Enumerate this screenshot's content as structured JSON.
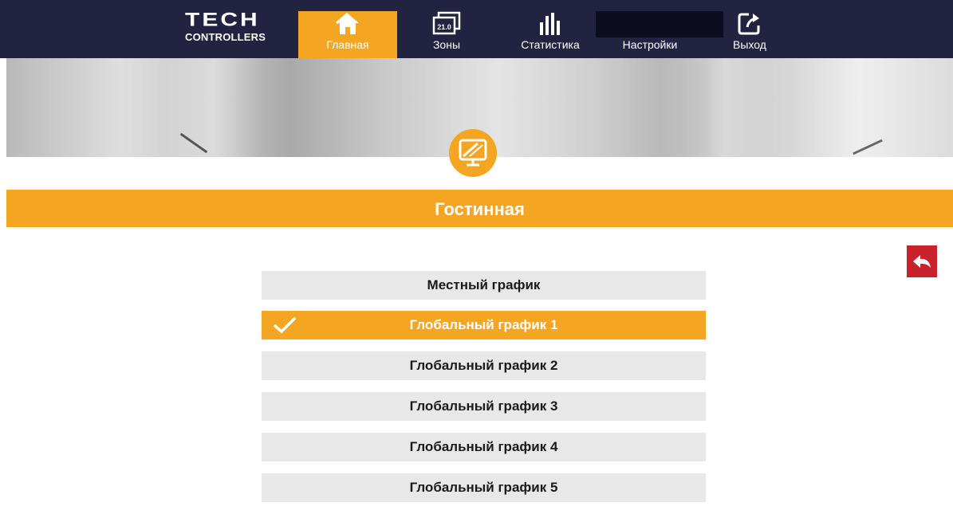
{
  "brand": {
    "name": "TECH",
    "subtitle": "CONTROLLERS"
  },
  "nav": {
    "items": [
      {
        "label": "Главная",
        "icon": "home-icon",
        "active": true
      },
      {
        "label": "Зоны",
        "icon": "zone-display-icon",
        "icon_text": "21.0",
        "active": false
      },
      {
        "label": "Статистика",
        "icon": "statistics-icon",
        "active": false
      },
      {
        "label": "Настройки",
        "icon": "settings-icon",
        "active": false
      },
      {
        "label": "Выход",
        "icon": "logout-icon",
        "active": false
      }
    ]
  },
  "room": {
    "title": "Гостинная",
    "icon": "room-display-icon"
  },
  "back_button": {
    "icon": "back-arrow-icon"
  },
  "schedules": [
    {
      "label": "Местный график",
      "selected": false
    },
    {
      "label": "Глобальный график 1",
      "selected": true
    },
    {
      "label": "Глобальный график 2",
      "selected": false
    },
    {
      "label": "Глобальный график 3",
      "selected": false
    },
    {
      "label": "Глобальный график 4",
      "selected": false
    },
    {
      "label": "Глобальный график 5",
      "selected": false
    }
  ],
  "colors": {
    "accent": "#f4a623",
    "topbar": "#212341",
    "back_button": "#c8232c",
    "item_background": "#e8e8e8"
  }
}
